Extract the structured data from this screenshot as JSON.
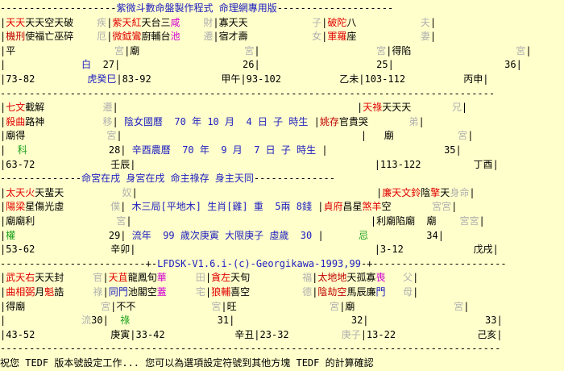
{
  "header_line": {
    "pre": "--------------------",
    "title": "紫微斗數命盤製作程式 命理網專用版",
    "post": "--------------------"
  },
  "row1": [
    {
      "cells": [
        {
          "t": "|",
          "c": ""
        },
        {
          "t": "天天",
          "c": "red"
        },
        {
          "t": "天天空天破",
          "c": ""
        },
        {
          "t": "    ",
          "c": ""
        },
        {
          "t": "疾",
          "c": "grey"
        },
        {
          "t": "|",
          "c": ""
        },
        {
          "t": "紫天",
          "c": "red"
        },
        {
          "t": "紅",
          "c": "red"
        },
        {
          "t": "天台三",
          "c": ""
        },
        {
          "t": "咸",
          "c": "mag"
        },
        {
          "t": "    ",
          "c": ""
        },
        {
          "t": "財",
          "c": "grey"
        },
        {
          "t": "|寡天天",
          "c": ""
        },
        {
          "t": "           ",
          "c": ""
        },
        {
          "t": "子",
          "c": "grey"
        },
        {
          "t": "|",
          "c": ""
        },
        {
          "t": "破",
          "c": "red"
        },
        {
          "t": "陀",
          "c": "red"
        },
        {
          "t": "八",
          "c": ""
        },
        {
          "t": "           ",
          "c": ""
        },
        {
          "t": "夫",
          "c": "grey"
        },
        {
          "t": "|",
          "c": ""
        }
      ]
    },
    {
      "cells": [
        {
          "t": "|",
          "c": ""
        },
        {
          "t": "機刑",
          "c": "dred"
        },
        {
          "t": "使福亡巫碎",
          "c": ""
        },
        {
          "t": "    ",
          "c": ""
        },
        {
          "t": "厄",
          "c": "grey"
        },
        {
          "t": "|",
          "c": ""
        },
        {
          "t": "微鉞",
          "c": "red"
        },
        {
          "t": "鸞",
          "c": "red"
        },
        {
          "t": "廚輔台",
          "c": ""
        },
        {
          "t": "池",
          "c": "mag"
        },
        {
          "t": "    ",
          "c": ""
        },
        {
          "t": "遷",
          "c": "grey"
        },
        {
          "t": "|宿才壽",
          "c": ""
        },
        {
          "t": "           ",
          "c": ""
        },
        {
          "t": "女",
          "c": "grey"
        },
        {
          "t": "|",
          "c": ""
        },
        {
          "t": "軍羅",
          "c": "red"
        },
        {
          "t": "座",
          "c": ""
        },
        {
          "t": "           ",
          "c": ""
        },
        {
          "t": "妻",
          "c": "grey"
        },
        {
          "t": "|",
          "c": ""
        }
      ]
    },
    {
      "cells": [
        {
          "t": "|平",
          "c": ""
        },
        {
          "t": "                 ",
          "c": ""
        },
        {
          "t": "宮",
          "c": "grey"
        },
        {
          "t": "|廟",
          "c": ""
        },
        {
          "t": "                  ",
          "c": ""
        },
        {
          "t": "宮",
          "c": "grey"
        },
        {
          "t": "|",
          "c": ""
        },
        {
          "t": "                    ",
          "c": ""
        },
        {
          "t": "宮",
          "c": "grey"
        },
        {
          "t": "|得陷",
          "c": ""
        },
        {
          "t": "                  ",
          "c": ""
        },
        {
          "t": "宮",
          "c": "grey"
        },
        {
          "t": "|",
          "c": ""
        }
      ]
    },
    {
      "cells": [
        {
          "t": "|             ",
          "c": ""
        },
        {
          "t": "白",
          "c": "blue"
        },
        {
          "t": "  27|",
          "c": ""
        },
        {
          "t": "                     26|",
          "c": ""
        },
        {
          "t": "                    25|",
          "c": ""
        },
        {
          "t": "                   36|",
          "c": ""
        }
      ]
    },
    {
      "cells": [
        {
          "t": "|73-82         ",
          "c": ""
        },
        {
          "t": "虎癸巳",
          "c": "blue"
        },
        {
          "t": "|83-92            甲午|93-102          乙未|103-112          丙申|",
          "c": ""
        }
      ]
    }
  ],
  "row2": [
    {
      "cells": [
        {
          "t": "|",
          "c": ""
        },
        {
          "t": "七文",
          "c": "red"
        },
        {
          "t": "截解",
          "c": ""
        },
        {
          "t": "          ",
          "c": ""
        },
        {
          "t": "遷",
          "c": "grey"
        },
        {
          "t": "|",
          "c": ""
        },
        {
          "t": "                                         ",
          "c": ""
        },
        {
          "t": "|",
          "c": ""
        },
        {
          "t": "天祿",
          "c": "red"
        },
        {
          "t": "天天天",
          "c": ""
        },
        {
          "t": "       ",
          "c": ""
        },
        {
          "t": "兄",
          "c": "grey"
        },
        {
          "t": "|",
          "c": ""
        }
      ]
    },
    {
      "cells": [
        {
          "t": "|",
          "c": ""
        },
        {
          "t": "殺曲",
          "c": "red"
        },
        {
          "t": "路神",
          "c": ""
        },
        {
          "t": "          ",
          "c": ""
        },
        {
          "t": "移",
          "c": "grey"
        },
        {
          "t": "| ",
          "c": ""
        },
        {
          "t": "陰女國曆  70 年 10 月  4 日 子 時生",
          "c": "blue"
        },
        {
          "t": " |",
          "c": ""
        },
        {
          "t": "姚存",
          "c": "dred"
        },
        {
          "t": "官貴哭",
          "c": ""
        },
        {
          "t": "       ",
          "c": ""
        },
        {
          "t": "弟",
          "c": "grey"
        },
        {
          "t": "|",
          "c": ""
        }
      ]
    },
    {
      "cells": [
        {
          "t": "|廟得",
          "c": ""
        },
        {
          "t": "              ",
          "c": ""
        },
        {
          "t": "宮",
          "c": "grey"
        },
        {
          "t": "|",
          "c": ""
        },
        {
          "t": "                                         ",
          "c": ""
        },
        {
          "t": "|   廟",
          "c": ""
        },
        {
          "t": "           ",
          "c": ""
        },
        {
          "t": "宮",
          "c": "grey"
        },
        {
          "t": "|",
          "c": ""
        }
      ]
    },
    {
      "cells": [
        {
          "t": "|  ",
          "c": ""
        },
        {
          "t": "科",
          "c": "green"
        },
        {
          "t": "              28| ",
          "c": ""
        },
        {
          "t": "辛酉農曆  70 年  9 月  7 日 子 時生",
          "c": "blue"
        },
        {
          "t": " |",
          "c": ""
        },
        {
          "t": "                    35|",
          "c": ""
        }
      ]
    },
    {
      "cells": [
        {
          "t": "|63-72             壬辰|                                         |113-122         丁酉|",
          "c": ""
        }
      ]
    }
  ],
  "mid_line": {
    "pre": "--------------",
    "text": "命宮在戌 身宮在戌 命主祿存 身主天同",
    "post": "--------------"
  },
  "row3": [
    {
      "cells": [
        {
          "t": "|",
          "c": ""
        },
        {
          "t": "太天",
          "c": "red"
        },
        {
          "t": "火",
          "c": "red"
        },
        {
          "t": "天蜚天",
          "c": ""
        },
        {
          "t": "          ",
          "c": ""
        },
        {
          "t": "奴",
          "c": "grey"
        },
        {
          "t": "|",
          "c": ""
        },
        {
          "t": "                                         ",
          "c": ""
        },
        {
          "t": "|",
          "c": ""
        },
        {
          "t": "廉天",
          "c": "red"
        },
        {
          "t": "文鈴",
          "c": "red"
        },
        {
          "t": "陰",
          "c": ""
        },
        {
          "t": "擎",
          "c": "red"
        },
        {
          "t": "天",
          "c": ""
        },
        {
          "t": "身命",
          "c": "grey"
        },
        {
          "t": "|",
          "c": ""
        }
      ]
    },
    {
      "cells": [
        {
          "t": "|",
          "c": ""
        },
        {
          "t": "陽梁",
          "c": "red"
        },
        {
          "t": "星傷光虛",
          "c": ""
        },
        {
          "t": "        ",
          "c": ""
        },
        {
          "t": "僕",
          "c": "grey"
        },
        {
          "t": "| ",
          "c": ""
        },
        {
          "t": "木三局[平地木] 生肖[雞] 重  5兩 8錢",
          "c": "blue"
        },
        {
          "t": " |",
          "c": ""
        },
        {
          "t": "貞府",
          "c": "red"
        },
        {
          "t": "昌",
          "c": ""
        },
        {
          "t": "星",
          "c": ""
        },
        {
          "t": "煞",
          "c": "red"
        },
        {
          "t": "羊",
          "c": "red"
        },
        {
          "t": "空",
          "c": ""
        },
        {
          "t": "       ",
          "c": ""
        },
        {
          "t": "宮宮",
          "c": "grey"
        },
        {
          "t": "|",
          "c": ""
        }
      ]
    },
    {
      "cells": [
        {
          "t": "|廟廟利",
          "c": ""
        },
        {
          "t": "              ",
          "c": ""
        },
        {
          "t": "宮",
          "c": "grey"
        },
        {
          "t": "|",
          "c": ""
        },
        {
          "t": "                                         ",
          "c": ""
        },
        {
          "t": "|利廟陷廟  廟",
          "c": ""
        },
        {
          "t": "    ",
          "c": ""
        },
        {
          "t": "宮宮",
          "c": "grey"
        },
        {
          "t": "|",
          "c": ""
        }
      ]
    },
    {
      "cells": [
        {
          "t": "|",
          "c": ""
        },
        {
          "t": "權",
          "c": "green"
        },
        {
          "t": "                29| ",
          "c": ""
        },
        {
          "t": "流年  99 歲次庚寅 大限庚子 虛歲  30",
          "c": "blue"
        },
        {
          "t": " |      ",
          "c": ""
        },
        {
          "t": "忌",
          "c": "green"
        },
        {
          "t": "          34|",
          "c": ""
        }
      ]
    },
    {
      "cells": [
        {
          "t": "|53-62             辛卯|                                         |3-12            戊戌|",
          "c": ""
        }
      ]
    }
  ],
  "lfdsk_line": {
    "pre": "-------------------------+-",
    "text": "LFDSK-V1.6.i-(c)-Georgikawa-1993,99",
    "post": "-+-----------------------"
  },
  "row4": [
    {
      "cells": [
        {
          "t": "|",
          "c": ""
        },
        {
          "t": "武天",
          "c": "red"
        },
        {
          "t": "右",
          "c": "red"
        },
        {
          "t": "天天封",
          "c": ""
        },
        {
          "t": "     ",
          "c": ""
        },
        {
          "t": "官",
          "c": "grey"
        },
        {
          "t": "|",
          "c": ""
        },
        {
          "t": "天",
          "c": "red"
        },
        {
          "t": "苴",
          "c": "red"
        },
        {
          "t": "龍鳳旬",
          "c": ""
        },
        {
          "t": "華",
          "c": "mag"
        },
        {
          "t": "     ",
          "c": ""
        },
        {
          "t": "田",
          "c": "grey"
        },
        {
          "t": "|",
          "c": ""
        },
        {
          "t": "貪左",
          "c": "red"
        },
        {
          "t": "天旬",
          "c": ""
        },
        {
          "t": "         ",
          "c": ""
        },
        {
          "t": "福",
          "c": "grey"
        },
        {
          "t": "|",
          "c": ""
        },
        {
          "t": "太地地",
          "c": "dred"
        },
        {
          "t": "天孤寡",
          "c": ""
        },
        {
          "t": "喪",
          "c": "mag"
        },
        {
          "t": "   ",
          "c": ""
        },
        {
          "t": "父",
          "c": "grey"
        },
        {
          "t": "|",
          "c": ""
        }
      ]
    },
    {
      "cells": [
        {
          "t": "|",
          "c": ""
        },
        {
          "t": "曲相",
          "c": "red"
        },
        {
          "t": "弼",
          "c": "red"
        },
        {
          "t": "月",
          "c": ""
        },
        {
          "t": "魁",
          "c": "red"
        },
        {
          "t": "誥",
          "c": ""
        },
        {
          "t": "     ",
          "c": ""
        },
        {
          "t": "祿",
          "c": "grey"
        },
        {
          "t": "|",
          "c": ""
        },
        {
          "t": "同門",
          "c": "blue"
        },
        {
          "t": "池閣空",
          "c": ""
        },
        {
          "t": "蓋",
          "c": "mag"
        },
        {
          "t": "     ",
          "c": ""
        },
        {
          "t": "宅",
          "c": "grey"
        },
        {
          "t": "|",
          "c": ""
        },
        {
          "t": "狼輔",
          "c": "red"
        },
        {
          "t": "喜空",
          "c": ""
        },
        {
          "t": "         ",
          "c": ""
        },
        {
          "t": "德",
          "c": "grey"
        },
        {
          "t": "|",
          "c": ""
        },
        {
          "t": "陰劫空",
          "c": "dred"
        },
        {
          "t": "馬辰廉",
          "c": ""
        },
        {
          "t": "門",
          "c": "blue"
        },
        {
          "t": "   ",
          "c": ""
        },
        {
          "t": "母",
          "c": "grey"
        },
        {
          "t": "|",
          "c": ""
        }
      ]
    },
    {
      "cells": [
        {
          "t": "|得廟",
          "c": ""
        },
        {
          "t": "             ",
          "c": ""
        },
        {
          "t": "宮",
          "c": "grey"
        },
        {
          "t": "|不不",
          "c": ""
        },
        {
          "t": "             ",
          "c": ""
        },
        {
          "t": "宮",
          "c": "grey"
        },
        {
          "t": "|旺",
          "c": ""
        },
        {
          "t": "                ",
          "c": ""
        },
        {
          "t": "宮",
          "c": "grey"
        },
        {
          "t": "|廟",
          "c": ""
        },
        {
          "t": "                 ",
          "c": ""
        },
        {
          "t": "宮",
          "c": "grey"
        },
        {
          "t": "|",
          "c": ""
        }
      ]
    },
    {
      "cells": [
        {
          "t": "|",
          "c": ""
        },
        {
          "t": "             ",
          "c": ""
        },
        {
          "t": "流",
          "c": "grey"
        },
        {
          "t": "30|  ",
          "c": ""
        },
        {
          "t": "祿",
          "c": "green"
        },
        {
          "t": "               31|",
          "c": ""
        },
        {
          "t": "                    32|",
          "c": ""
        },
        {
          "t": "                    33|",
          "c": ""
        }
      ]
    },
    {
      "cells": [
        {
          "t": "|43-52             庚寅|33-42            辛丑|23-32         ",
          "c": ""
        },
        {
          "t": "庚子",
          "c": "grey"
        },
        {
          "t": "|13-22              己亥|",
          "c": ""
        }
      ]
    }
  ],
  "bottom_hr": "--------------------------------------------------------------------------------------",
  "footer_text": "祝您 TEDF 版本號設定工作... 您可以為選項設定符號到其他方塊 TEDF 的計算確認",
  "rule_lines": {
    "r1": "-------------------------------------------------------------------------------------",
    "r2": "-------------------------------------------------------------------------------------"
  }
}
